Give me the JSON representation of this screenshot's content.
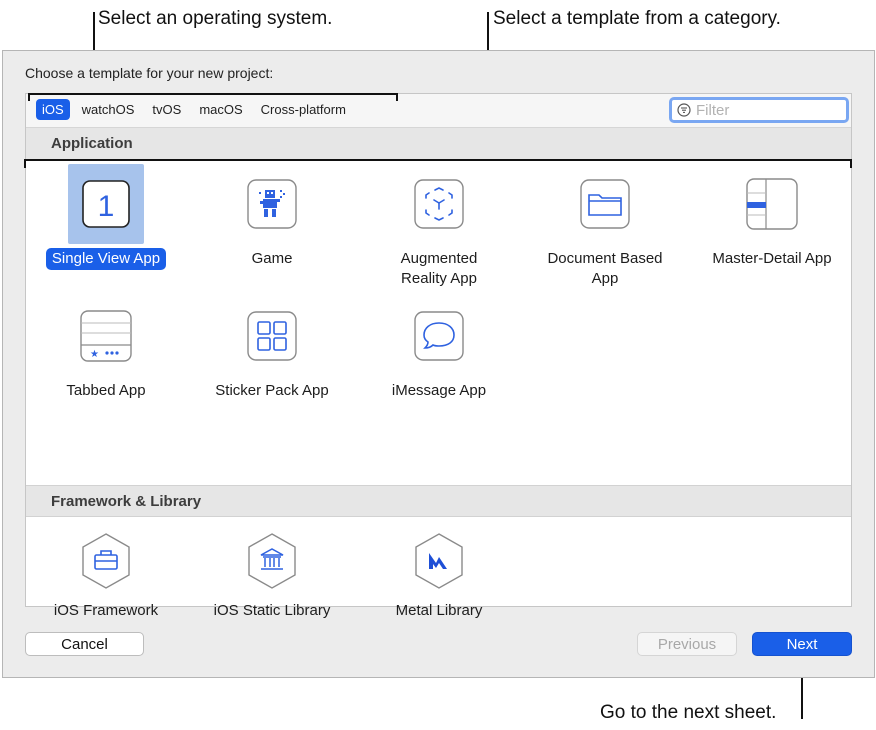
{
  "annotations": {
    "os": "Select an operating system.",
    "template": "Select a template from a category.",
    "next": "Go to the next sheet."
  },
  "dialog": {
    "prompt": "Choose a template for your new project:"
  },
  "os_tabs": [
    {
      "label": "iOS",
      "selected": true
    },
    {
      "label": "watchOS",
      "selected": false
    },
    {
      "label": "tvOS",
      "selected": false
    },
    {
      "label": "macOS",
      "selected": false
    },
    {
      "label": "Cross-platform",
      "selected": false
    }
  ],
  "filter": {
    "placeholder": "Filter",
    "icon": "filter-icon"
  },
  "sections": [
    {
      "title": "Application",
      "items": [
        {
          "label": "Single View App",
          "icon": "single-view-app-icon",
          "selected": true
        },
        {
          "label": "Game",
          "icon": "game-icon",
          "selected": false
        },
        {
          "label": "Augmented\nReality App",
          "icon": "augmented-reality-icon",
          "selected": false
        },
        {
          "label": "Document Based\nApp",
          "icon": "document-based-app-icon",
          "selected": false
        },
        {
          "label": "Master-Detail App",
          "icon": "master-detail-app-icon",
          "selected": false
        },
        {
          "label": "Tabbed App",
          "icon": "tabbed-app-icon",
          "selected": false
        },
        {
          "label": "Sticker Pack App",
          "icon": "sticker-pack-app-icon",
          "selected": false
        },
        {
          "label": "iMessage App",
          "icon": "imessage-app-icon",
          "selected": false
        }
      ]
    },
    {
      "title": "Framework & Library",
      "items": [
        {
          "label": "iOS Framework",
          "icon": "ios-framework-icon",
          "selected": false
        },
        {
          "label": "iOS Static Library",
          "icon": "ios-static-library-icon",
          "selected": false
        },
        {
          "label": "Metal Library",
          "icon": "metal-library-icon",
          "selected": false
        }
      ]
    }
  ],
  "single_view_icon_text": "1",
  "buttons": {
    "cancel": "Cancel",
    "previous": "Previous",
    "next": "Next",
    "previous_enabled": false
  },
  "colors": {
    "accent": "#1a5fe8",
    "icon_stroke": "#2f62e0",
    "selected_icon_bg": "#a7c3ec"
  }
}
